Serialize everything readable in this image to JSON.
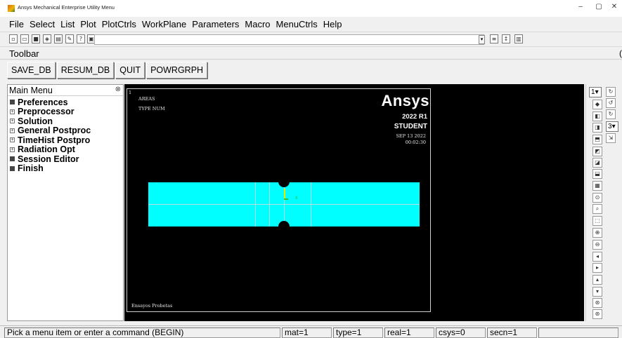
{
  "window": {
    "title": "Ansys Mechanical Enterprise Utility Menu"
  },
  "menubar": {
    "items": [
      "File",
      "Select",
      "List",
      "Plot",
      "PlotCtrls",
      "WorkPlane",
      "Parameters",
      "Macro",
      "MenuCtrls",
      "Help"
    ]
  },
  "toolbar_label": "Toolbar",
  "toolbar_buttons": [
    "SAVE_DB",
    "RESUM_DB",
    "QUIT",
    "POWRGRPH"
  ],
  "main_menu": {
    "title": "Main Menu",
    "items": [
      {
        "label": "Preferences",
        "marker": "solid"
      },
      {
        "label": "Preprocessor",
        "marker": "plus"
      },
      {
        "label": "Solution",
        "marker": "plus"
      },
      {
        "label": "General Postproc",
        "marker": "plus"
      },
      {
        "label": "TimeHist Postpro",
        "marker": "plus"
      },
      {
        "label": "Radiation Opt",
        "marker": "plus"
      },
      {
        "label": "Session Editor",
        "marker": "solid"
      },
      {
        "label": "Finish",
        "marker": "solid"
      }
    ]
  },
  "graphics": {
    "window_number": "1",
    "plot_type": "AREAS",
    "numbering": "TYPE NUM",
    "logo": "Ansys",
    "version": "2022 R1",
    "edition": "STUDENT",
    "date": "SEP 13 2022",
    "time": "00:02:30",
    "caption": "Ensayos Probetas",
    "axis_label": "X",
    "colors": {
      "background": "#000000",
      "area": "#00ffff"
    }
  },
  "right_strip": {
    "window_select": "1",
    "view_select": "3"
  },
  "status_bar": {
    "prompt": "Pick a menu item or enter a command (BEGIN)",
    "mat": "mat=1",
    "type": "type=1",
    "real": "real=1",
    "csys": "csys=0",
    "secn": "secn=1"
  }
}
